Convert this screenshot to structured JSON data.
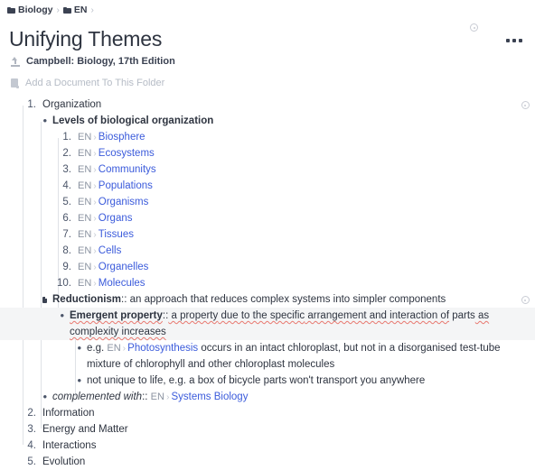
{
  "breadcrumb": {
    "items": [
      {
        "label": "Biology",
        "icon": "folder-icon"
      },
      {
        "label": "EN",
        "icon": "folder-icon"
      }
    ],
    "separator": "›"
  },
  "header": {
    "title": "Unifying Themes",
    "subtitle": "Campbell: Biology, 17th Edition",
    "add_document_label": "Add a Document To This Folder",
    "menu_label": "•••"
  },
  "colors": {
    "link": "#3b5bdb",
    "text": "#2e3440",
    "muted": "#8b93a1",
    "placeholder": "#b6bcc6",
    "spellcheck": "#e8786f",
    "highlight": "#f4f5f6",
    "rail": "#dfe2e7"
  },
  "outline": {
    "items": [
      {
        "marker": "1.",
        "text": "Organization"
      },
      {
        "marker": "•",
        "text": "Levels of biological organization"
      },
      {
        "marker": "1.",
        "lang": "EN",
        "link": "Biosphere"
      },
      {
        "marker": "2.",
        "lang": "EN",
        "link": "Ecosystems"
      },
      {
        "marker": "3.",
        "lang": "EN",
        "link": "Communitys"
      },
      {
        "marker": "4.",
        "lang": "EN",
        "link": "Populations"
      },
      {
        "marker": "5.",
        "lang": "EN",
        "link": "Organisms"
      },
      {
        "marker": "6.",
        "lang": "EN",
        "link": "Organs"
      },
      {
        "marker": "7.",
        "lang": "EN",
        "link": "Tissues"
      },
      {
        "marker": "8.",
        "lang": "EN",
        "link": "Cells"
      },
      {
        "marker": "9.",
        "lang": "EN",
        "link": "Organelles"
      },
      {
        "marker": "10.",
        "lang": "EN",
        "link": "Molecules"
      }
    ],
    "reductionism": {
      "term": "Reductionism",
      "sep": "::",
      "definition": " an approach that reduces complex systems into simpler components"
    },
    "emergent": {
      "term": "Emergent property",
      "sep": "::",
      "part1": " a property",
      "part2": " due to",
      "part3": " the specific",
      "part4": " arrangement and",
      "part5": " interaction of",
      "part6": " parts",
      "part7": " as",
      "part8": " complexity increases"
    },
    "examples": [
      {
        "prefix": "e.g.",
        "lang": "EN",
        "link": "Photosynthesis",
        "rest": " occurs in an intact chloroplast, but not in a disorganised test-tube mixture of chlorophyll and other chloroplast molecules"
      },
      {
        "text": "not unique to life, e.g. a box of bicycle parts won't transport you anywhere"
      }
    ],
    "complemented": {
      "term": "complemented with",
      "sep": "::",
      "lang": "EN",
      "link": "Systems Biology"
    },
    "tail_items": [
      {
        "marker": "2.",
        "text": "Information"
      },
      {
        "marker": "3.",
        "text": "Energy and Matter"
      },
      {
        "marker": "4.",
        "text": "Interactions"
      },
      {
        "marker": "5.",
        "text": "Evolution"
      }
    ]
  },
  "icons": {
    "gear": "gear-icon",
    "upload": "upload-icon",
    "document": "document-icon",
    "folder": "folder-icon",
    "chevron": "›"
  }
}
